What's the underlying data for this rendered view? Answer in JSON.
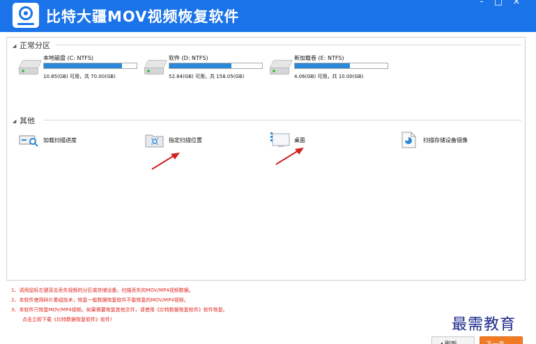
{
  "app": {
    "title": "比特大疆MOV视频恢复软件",
    "window_controls": {
      "minimize": "-",
      "maximize": "□",
      "close": "×"
    }
  },
  "partitions": {
    "heading": "正常分区",
    "drives": [
      {
        "name": "本地磁盘 (C: NTFS)",
        "size_text": "10.85(GB) 可用，共 70.00(GB)",
        "used_fraction": 0.845
      },
      {
        "name": "软件 (D: NTFS)",
        "size_text": "52.84(GB) 可用，共 158.05(GB)",
        "used_fraction": 0.666
      },
      {
        "name": "新加载卷 (E: NTFS)",
        "size_text": "4.06(GB) 可用，共 10.00(GB)",
        "used_fraction": 0.594
      }
    ]
  },
  "other": {
    "heading": "其他",
    "tools": [
      {
        "label": "加载扫描进度",
        "icon": "load-progress-icon"
      },
      {
        "label": "指定扫描位置",
        "icon": "scan-location-icon"
      },
      {
        "label": "桌面",
        "icon": "desktop-icon"
      },
      {
        "label": "扫描存储设备镜像",
        "icon": "disk-image-icon"
      }
    ]
  },
  "notes": [
    "1、请用鼠标左键双击丢失视频的分区或存储设备，扫描丢失的MOV/MP4视频数据。",
    "2、本软件使用碎片重组技术，恢复一般数据恢复软件不能恢复的MOV/MP4视频。",
    "3、本软件只恢复MOV/MP4视频。如果需要恢复其他文件，请使用《比特数据恢复软件》软件恢复。",
    "点击立即下载《比特数据恢复软件》软件！"
  ],
  "buttons": {
    "refresh": "◢ 刷新",
    "scan": "下一步"
  },
  "watermark": "最需教育",
  "colors": {
    "titlebar": "#1a73e8",
    "bar_fill": "#2b88d8",
    "note_text": "#e0261e",
    "scan_button": "#f07b24",
    "arrow": "#d42020"
  }
}
